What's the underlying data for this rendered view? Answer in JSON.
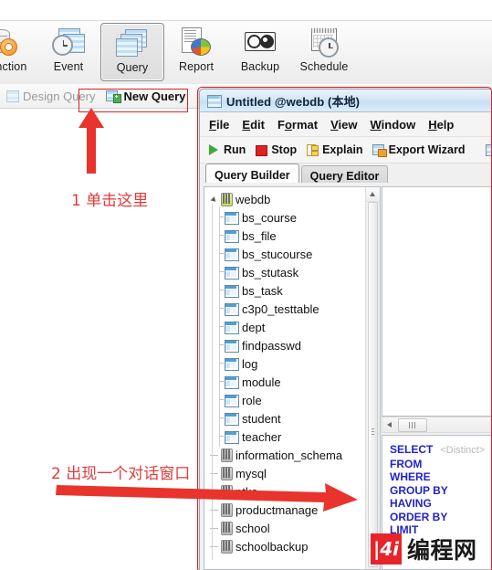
{
  "app_toolbar": {
    "items": [
      {
        "label": "Function",
        "icon": "function-icon",
        "selected": false
      },
      {
        "label": "Event",
        "icon": "event-icon",
        "selected": false
      },
      {
        "label": "Query",
        "icon": "query-icon",
        "selected": true
      },
      {
        "label": "Report",
        "icon": "report-icon",
        "selected": false
      },
      {
        "label": "Backup",
        "icon": "backup-icon",
        "selected": false
      },
      {
        "label": "Schedule",
        "icon": "schedule-icon",
        "selected": false
      }
    ]
  },
  "sub_toolbar": {
    "items": [
      {
        "label": "Design Query",
        "icon": "design-query-icon",
        "enabled": false
      },
      {
        "label": "New Query",
        "icon": "new-query-icon",
        "enabled": true
      },
      {
        "label": "",
        "icon": "partial-icon",
        "enabled": false
      }
    ]
  },
  "annotations": {
    "step1": "1 单击这里",
    "step2": "2 出现一个对话窗口",
    "highlight_color": "#e02020"
  },
  "dialog": {
    "title": "Untitled @webdb (本地)",
    "title_icon": "window-icon",
    "menus": [
      {
        "mnemonic": "F",
        "rest": "ile"
      },
      {
        "mnemonic": "E",
        "rest": "dit"
      },
      {
        "pre": "F",
        "mnemonic": "o",
        "rest": "rmat"
      },
      {
        "mnemonic": "V",
        "rest": "iew"
      },
      {
        "mnemonic": "W",
        "rest": "indow"
      },
      {
        "mnemonic": "H",
        "rest": "elp"
      }
    ],
    "toolbar": [
      {
        "label": "Run",
        "icon": "run-play-icon"
      },
      {
        "label": "Stop",
        "icon": "stop-square-icon"
      },
      {
        "label": "Explain",
        "icon": "explain-icon"
      },
      {
        "label": "Export Wizard",
        "icon": "export-wizard-icon"
      }
    ],
    "tabs": [
      {
        "label": "Query Builder",
        "active": true
      },
      {
        "label": "Query Editor",
        "active": false
      }
    ],
    "tree": [
      {
        "label": "webdb",
        "type": "database",
        "depth": 0,
        "expanded": true
      },
      {
        "label": "bs_course",
        "type": "table",
        "depth": 1
      },
      {
        "label": "bs_file",
        "type": "table",
        "depth": 1
      },
      {
        "label": "bs_stucourse",
        "type": "table",
        "depth": 1
      },
      {
        "label": "bs_stutask",
        "type": "table",
        "depth": 1
      },
      {
        "label": "bs_task",
        "type": "table",
        "depth": 1
      },
      {
        "label": "c3p0_testtable",
        "type": "table",
        "depth": 1
      },
      {
        "label": "dept",
        "type": "table",
        "depth": 1
      },
      {
        "label": "findpasswd",
        "type": "table",
        "depth": 1
      },
      {
        "label": "log",
        "type": "table",
        "depth": 1
      },
      {
        "label": "module",
        "type": "table",
        "depth": 1
      },
      {
        "label": "role",
        "type": "table",
        "depth": 1
      },
      {
        "label": "student",
        "type": "table",
        "depth": 1
      },
      {
        "label": "teacher",
        "type": "table",
        "depth": 1
      },
      {
        "label": "information_schema",
        "type": "database",
        "depth": 0
      },
      {
        "label": "mysql",
        "type": "database",
        "depth": 0
      },
      {
        "label": "ntko",
        "type": "database",
        "depth": 0
      },
      {
        "label": "productmanage",
        "type": "database",
        "depth": 0
      },
      {
        "label": "school",
        "type": "database",
        "depth": 0
      },
      {
        "label": "schoolbackup",
        "type": "database",
        "depth": 0
      }
    ],
    "sql_keywords": [
      {
        "kw": "SELECT",
        "extra": "<Distinct>"
      },
      {
        "kw": "FROM",
        "extra": ""
      },
      {
        "kw": "WHERE",
        "extra": ""
      },
      {
        "kw": "GROUP BY",
        "extra": ""
      },
      {
        "kw": "HAVING",
        "extra": ""
      },
      {
        "kw": "ORDER BY",
        "extra": ""
      },
      {
        "kw": "LIMIT",
        "extra": ""
      }
    ],
    "keyword_color": "#2222cc"
  },
  "watermark": {
    "mark": "|4i",
    "text": "编程网"
  }
}
